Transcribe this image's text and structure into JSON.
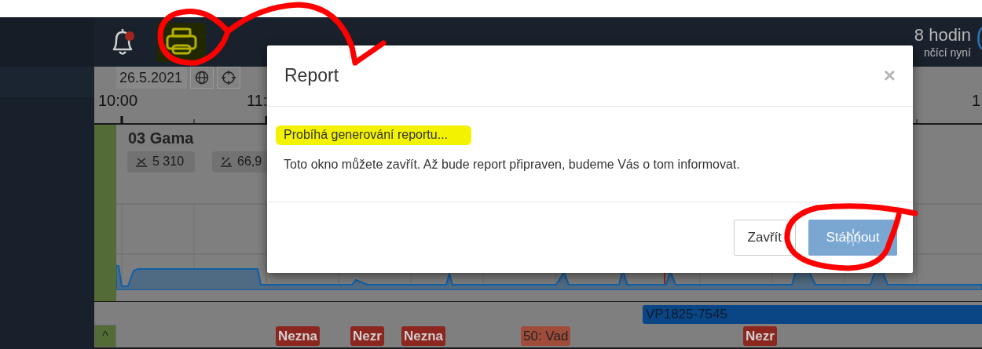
{
  "navbar": {
    "notification_badge": true,
    "range": "8 hodin",
    "range_caption": "nčící nyní"
  },
  "toolbar": {
    "date": "26.5.2021"
  },
  "timeline": {
    "ticks": [
      "10:00",
      "11:",
      "1"
    ]
  },
  "line": {
    "name": "03 Gama",
    "stats": [
      {
        "kind": "count",
        "value": "5 310"
      },
      {
        "kind": "percent",
        "value": "66,9"
      }
    ],
    "bar": "VP1825-7545",
    "collapse": "^",
    "events": [
      {
        "label": "Nezna",
        "kind": "error"
      },
      {
        "label": "Nezr",
        "kind": "error"
      },
      {
        "label": "Nezna",
        "kind": "error"
      },
      {
        "label": "50: Vad",
        "kind": "warning"
      },
      {
        "label": "Nezr",
        "kind": "error"
      }
    ]
  },
  "modal": {
    "title": "Report",
    "close": "×",
    "status": "Probíhá generování reportu...",
    "message": "Toto okno můžete zavřít. Až bude report připraven, budeme Vás o tom informovat.",
    "buttons": [
      {
        "label": "Zavřít",
        "kind": "default",
        "loading": false
      },
      {
        "label": "Stáhnout",
        "kind": "primary",
        "loading": true
      }
    ]
  },
  "annotations": [
    {
      "kind": "printer-highlight"
    },
    {
      "kind": "printer-circle-arrow"
    },
    {
      "kind": "status-highlight"
    },
    {
      "kind": "download-circle"
    }
  ]
}
